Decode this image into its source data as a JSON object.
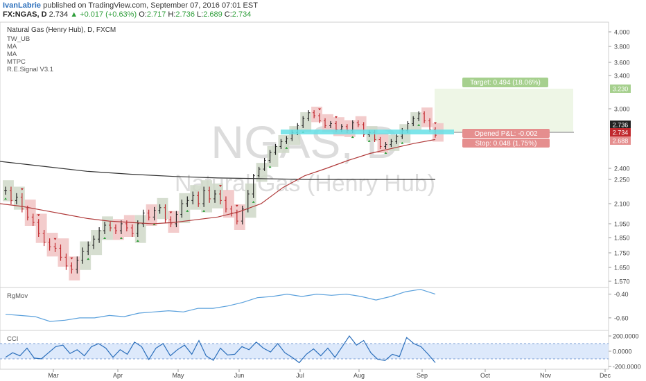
{
  "header": {
    "author": "IvanLabrie",
    "published_text": "published on TradingView.com, September 07, 2016 07:01 EST",
    "symbol": "FX:NGAS, D",
    "last": "2.734",
    "change_arrow": "▲",
    "change": "+0.017 (+0.63%)",
    "open_label": "O:",
    "open": "2.717",
    "high_label": "H:",
    "high": "2.736",
    "low_label": "L:",
    "low": "2.689",
    "close_label": "C:",
    "close": "2.734"
  },
  "legend": {
    "title": "Natural Gas (Henry Hub), D, FXCM",
    "items": [
      "TW_UB",
      "MA",
      "MA",
      "MTPC",
      "R.E.Signal V3.1"
    ]
  },
  "watermark": {
    "symbol": "NGAS, D",
    "name": "Natural Gas (Henry Hub)"
  },
  "colors": {
    "bull_box": "#cfd8c8",
    "bear_box": "#f1c3c3",
    "ma_fast": "#b03a3a",
    "ma_slow": "#333333",
    "target_zone": "#eef6e6",
    "target_label": "#a6d08e",
    "stop_label": "#e58e8e",
    "entry_line": "#66e0e6",
    "rgmov_line": "#5aa0dc",
    "cci_line": "#2a6ebb",
    "cci_band": "#dde9fb"
  },
  "trade": {
    "target_label": "Target: 0.494 (18.06%)",
    "opened_label": "Opened P&L: -0.002",
    "stop_label": "Stop: 0.048 (1.75%)",
    "target_price": 3.23,
    "entry_price": 2.736,
    "stop_price": 2.688
  },
  "chart_data": [
    {
      "type": "line",
      "title": "Natural Gas (Henry Hub), D, FXCM",
      "y_ticks": [
        "4.000",
        "3.800",
        "3.600",
        "3.400",
        "3.000",
        "2.400",
        "2.250",
        "2.100",
        "1.950",
        "1.850",
        "1.750",
        "1.650",
        "1.570"
      ],
      "y_tick_values": [
        4.0,
        3.8,
        3.6,
        3.4,
        3.0,
        2.4,
        2.25,
        2.1,
        1.95,
        1.85,
        1.75,
        1.65,
        1.57
      ],
      "price_labels": [
        {
          "text": "3.230",
          "value": 3.23,
          "color": "#a6d08e"
        },
        {
          "text": "2.736",
          "value": 2.736,
          "color": "#222222"
        },
        {
          "text": "2.734",
          "value": 2.734,
          "color": "#c0282d"
        },
        {
          "text": "2.688",
          "value": 2.688,
          "color": "#e58e8e"
        }
      ],
      "x_labels": [
        "Mar",
        "Apr",
        "May",
        "Jun",
        "Jul",
        "Aug",
        "Sep",
        "Oct",
        "Nov",
        "Dec"
      ],
      "series": [
        {
          "name": "close",
          "values": [
            2.18,
            2.12,
            2.14,
            2.06,
            2.0,
            1.96,
            1.88,
            1.82,
            1.79,
            1.78,
            1.72,
            1.66,
            1.64,
            1.7,
            1.76,
            1.8,
            1.84,
            1.9,
            1.94,
            1.92,
            1.9,
            1.95,
            1.92,
            1.88,
            1.95,
            2.03,
            2.0,
            2.05,
            2.07,
            1.98,
            1.95,
            2.02,
            2.1,
            2.12,
            2.15,
            2.1,
            2.18,
            2.13,
            2.16,
            2.12,
            2.06,
            2.03,
            1.97,
            2.06,
            2.16,
            2.3,
            2.39,
            2.48,
            2.56,
            2.62,
            2.67,
            2.7,
            2.76,
            2.83,
            2.9,
            2.96,
            2.93,
            2.88,
            2.83,
            2.85,
            2.79,
            2.82,
            2.78,
            2.86,
            2.84,
            2.74,
            2.76,
            2.69,
            2.62,
            2.64,
            2.67,
            2.72,
            2.78,
            2.85,
            2.9,
            2.95,
            2.88,
            2.79,
            2.734
          ]
        },
        {
          "name": "MA",
          "values": [
            2.1,
            2.08,
            2.05,
            2.02,
            1.99,
            1.97,
            1.96,
            1.95,
            1.96,
            1.98,
            2.0,
            2.04,
            2.1,
            2.2,
            2.3,
            2.4,
            2.48,
            2.55,
            2.6,
            2.65,
            2.69
          ]
        },
        {
          "name": "MA",
          "values": [
            2.47,
            2.42,
            2.36,
            2.32,
            2.29,
            2.27,
            2.26,
            2.25,
            2.25,
            2.25,
            2.25
          ]
        }
      ],
      "xlabel": "",
      "ylabel": ""
    },
    {
      "type": "line",
      "title": "RgMov",
      "y_ticks": [
        "-0.40",
        "-0.60"
      ],
      "values": [
        -0.57,
        -0.58,
        -0.59,
        -0.63,
        -0.62,
        -0.6,
        -0.6,
        -0.58,
        -0.59,
        -0.56,
        -0.55,
        -0.54,
        -0.55,
        -0.52,
        -0.52,
        -0.5,
        -0.47,
        -0.43,
        -0.42,
        -0.4,
        -0.42,
        -0.4,
        -0.41,
        -0.4,
        -0.42,
        -0.45,
        -0.42,
        -0.38,
        -0.36,
        -0.4
      ]
    },
    {
      "type": "line",
      "title": "CCI",
      "y_ticks": [
        "200.0000",
        "0.0000",
        "-200.0000"
      ],
      "values": [
        -80,
        -20,
        -60,
        40,
        -90,
        -100,
        -20,
        60,
        80,
        -30,
        20,
        -60,
        60,
        100,
        40,
        -80,
        20,
        -40,
        120,
        60,
        -110,
        40,
        100,
        -60,
        20,
        80,
        -40,
        140,
        -60,
        -120,
        40,
        -50,
        -40,
        60,
        20,
        120,
        40,
        -10,
        100,
        -20,
        -80,
        -150,
        -40,
        30,
        -60,
        40,
        -80,
        60,
        200,
        80,
        140,
        -20,
        -110,
        -120,
        -40,
        -70,
        180,
        100,
        60,
        -40,
        -150
      ]
    }
  ]
}
